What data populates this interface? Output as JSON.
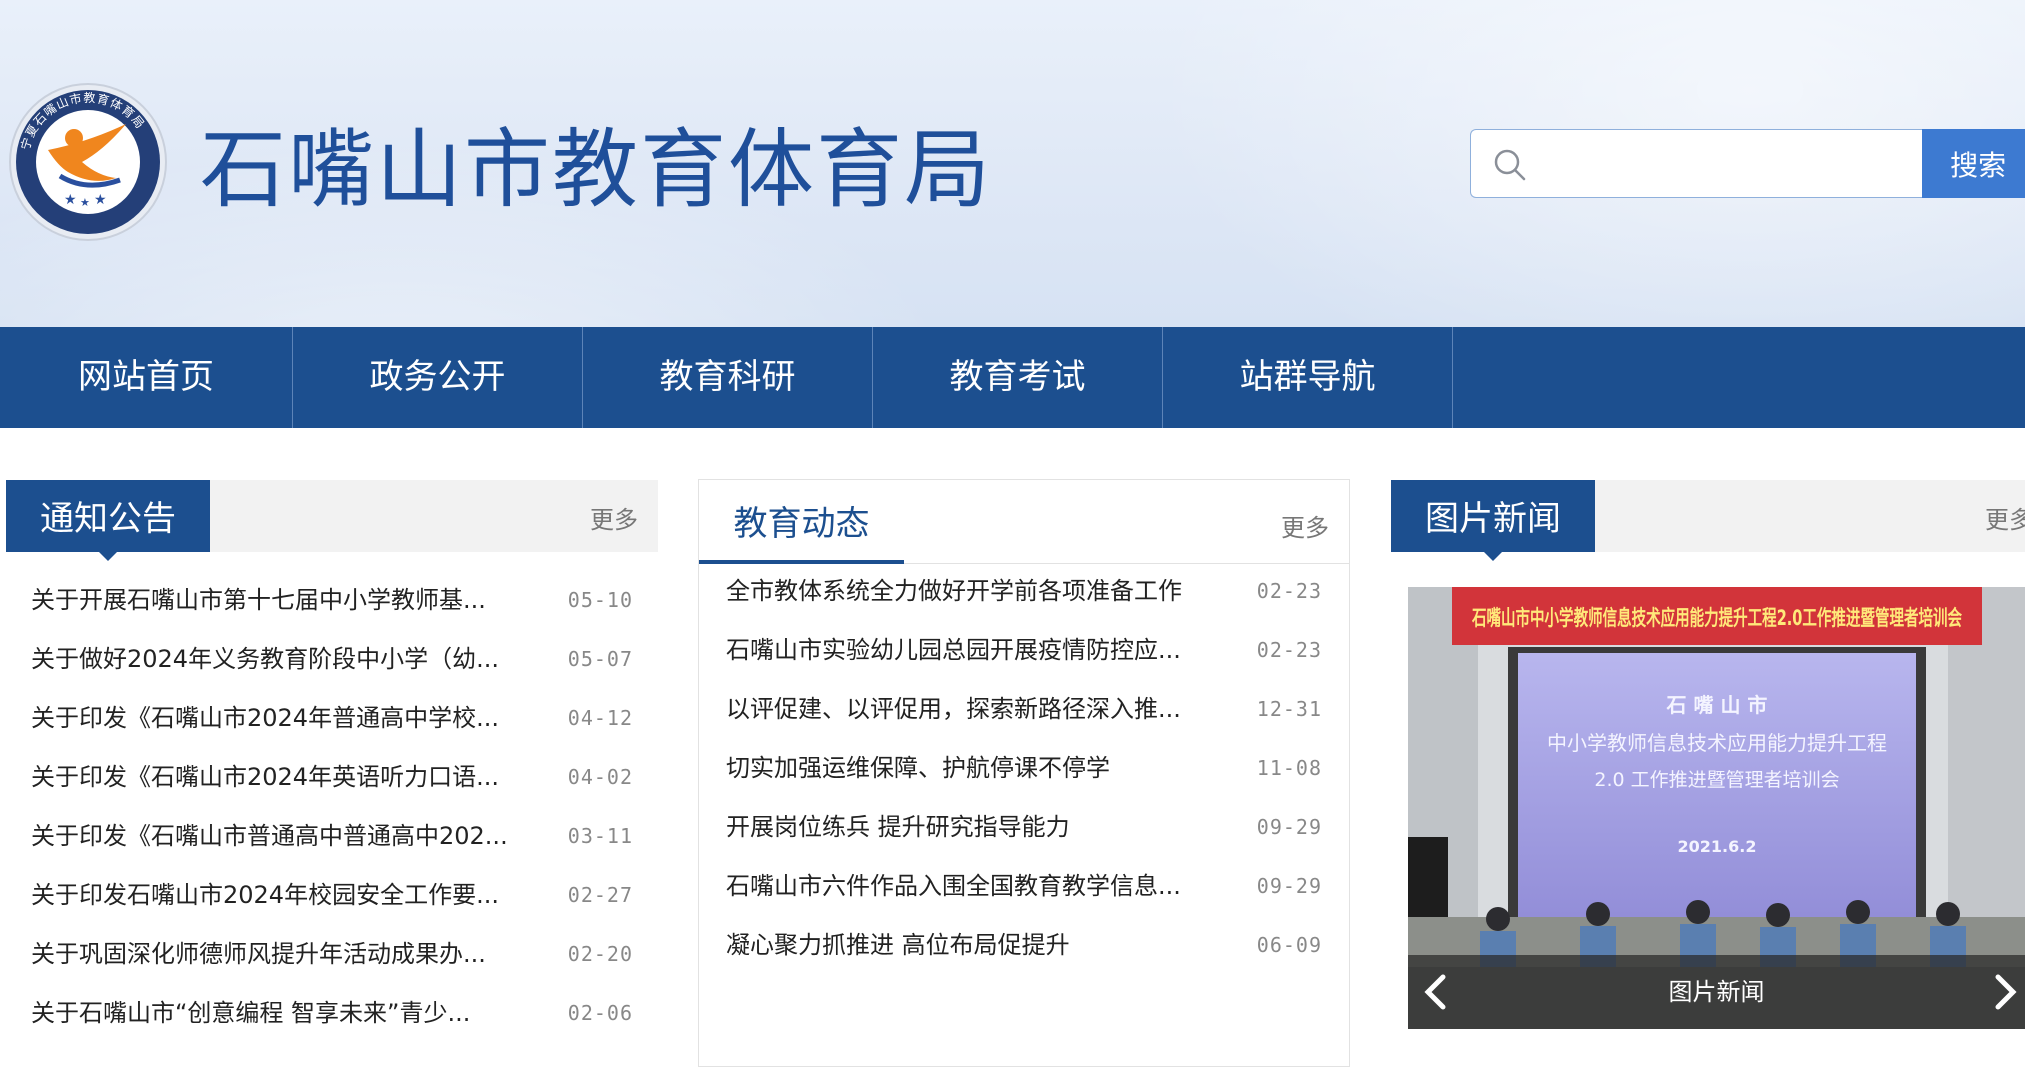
{
  "header": {
    "site_title": "石嘴山市教育体育局",
    "logo_text": "宁夏石嘴山市教育体育局",
    "search": {
      "placeholder": "",
      "button_label": "搜索"
    }
  },
  "nav": {
    "items": [
      {
        "label": "网站首页"
      },
      {
        "label": "政务公开"
      },
      {
        "label": "教育科研"
      },
      {
        "label": "教育考试"
      },
      {
        "label": "站群导航"
      }
    ]
  },
  "notices": {
    "title": "通知公告",
    "more": "更多",
    "items": [
      {
        "title": "关于开展石嘴山市第十七届中小学教师基...",
        "date": "05-10"
      },
      {
        "title": "关于做好2024年义务教育阶段中小学（幼...",
        "date": "05-07"
      },
      {
        "title": "关于印发《石嘴山市2024年普通高中学校...",
        "date": "04-12"
      },
      {
        "title": "关于印发《石嘴山市2024年英语听力口语...",
        "date": "04-02"
      },
      {
        "title": "关于印发《石嘴山市普通高中普通高中202...",
        "date": "03-11"
      },
      {
        "title": "关于印发石嘴山市2024年校园安全工作要...",
        "date": "02-27"
      },
      {
        "title": "关于巩固深化师德师风提升年活动成果办...",
        "date": "02-20"
      },
      {
        "title": "关于石嘴山市“创意编程 智享未来”青少...",
        "date": "02-06"
      }
    ]
  },
  "edu_news": {
    "title": "教育动态",
    "more": "更多",
    "items": [
      {
        "title": "全市教体系统全力做好开学前各项准备工作",
        "date": "02-23"
      },
      {
        "title": "石嘴山市实验幼儿园总园开展疫情防控应...",
        "date": "02-23"
      },
      {
        "title": "以评促建、以评促用，探索新路径深入推...",
        "date": "12-31"
      },
      {
        "title": "切实加强运维保障、护航停课不停学",
        "date": "11-08"
      },
      {
        "title": "开展岗位练兵 提升研究指导能力",
        "date": "09-29"
      },
      {
        "title": "石嘴山市六件作品入围全国教育教学信息...",
        "date": "09-29"
      },
      {
        "title": "凝心聚力抓推进 高位布局促提升",
        "date": "06-09"
      }
    ]
  },
  "photo_news": {
    "title": "图片新闻",
    "more": "更多",
    "caption": "图片新闻",
    "banner": "石嘴山市中小学教师信息技术应用能力提升工程2.0工作推进暨管理者培训会",
    "screen_lines": [
      "石 嘴 山 市",
      "中小学教师信息技术应用能力提升工程",
      "2.0 工作推进暨管理者培训会",
      "2021.6.2"
    ]
  },
  "colors": {
    "primary": "#1c4f8f",
    "title_blue": "#1f4f9a",
    "search_button": "#3d7ad1",
    "banner_red": "#d2343a"
  }
}
